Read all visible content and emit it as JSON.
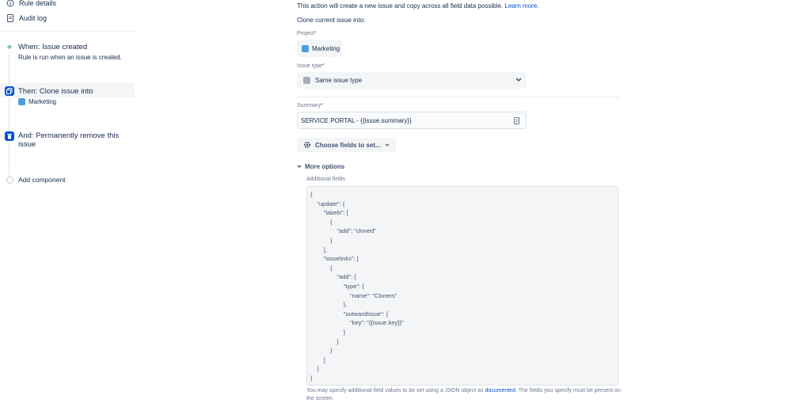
{
  "sidebar": {
    "rule_details": "Rule details",
    "audit_log": "Audit log",
    "trigger": {
      "title": "When: Issue created",
      "subtitle": "Rule is run when an issue is created."
    },
    "action": {
      "title": "Then: Clone issue into",
      "project": "Marketing"
    },
    "branch": {
      "title_line1": "And: Permanently remove this",
      "title_line2": "issue"
    },
    "add_component": "Add component"
  },
  "panel": {
    "intro_text": "This action will create a new issue and copy across all field data possible.",
    "intro_link": "Learn more.",
    "clone_label": "Clone current issue into:",
    "project": {
      "label": "Project",
      "value": "Marketing"
    },
    "issue_type": {
      "label": "Issue type",
      "value": "Same issue type"
    },
    "summary": {
      "label": "Summary",
      "value": "SERVICE PORTAL - {{issue.summary}}"
    },
    "choose_fields": "Choose fields to set...",
    "more_options": "More options",
    "additional_fields_label": "Additional fields",
    "json_lines": [
      "{",
      "    \"update\": {",
      "        \"labels\": [",
      "            {",
      "                \"add\": \"cloned\"",
      "            }",
      "        ],",
      "        \"issuelinks\": [",
      "            {",
      "                \"add\": {",
      "                    \"type\": {",
      "                        \"name\": \"Cloners\"",
      "                    },",
      "                    \"outwardIssue\": {",
      "                        \"key\": \"{{issue.key}}\"",
      "                    }",
      "                }",
      "            }",
      "        ]",
      "    }",
      "}"
    ],
    "help_text_1": "You may specify additional field values to be set using a JSON object as",
    "help_link": "documented",
    "help_text_2": ". The fields you specify must be present on",
    "help_text_3": "the screen."
  },
  "colors": {
    "accent": "#0052cc",
    "trigger": "#36b37e",
    "required": "#de350b"
  }
}
